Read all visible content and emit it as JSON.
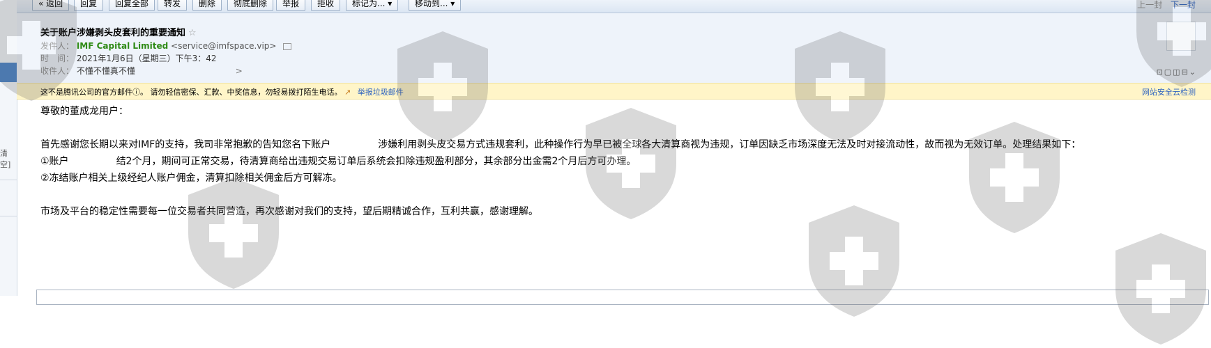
{
  "toolbar": {
    "back": "« 返回",
    "reply": "回复",
    "reply_all": "回复全部",
    "forward": "转发",
    "delete": "删除",
    "delete_permanently": "彻底删除",
    "report": "举报",
    "reject": "拒收",
    "mark_as": "标记为... ▾",
    "move_to": "移动到... ▾",
    "prev": "上一封",
    "next": "下一封"
  },
  "left": {
    "partial_label": "清空]"
  },
  "header": {
    "subject": "关于账户涉嫌剥头皮套利的重要通知",
    "star": "☆",
    "sender_label": "发件人：",
    "sender_name": "IMF Capital Limited",
    "sender_email": "<service@imfspace.vip>",
    "time_label": "时　间：",
    "time_value": "2021年1月6日（星期三）下午3：42",
    "recipient_label": "收件人：",
    "recipient_value": "不懂不懂真不懂",
    "recipient_more": ">",
    "tool_icons": "⊡▢◫⊟⌄"
  },
  "notice": {
    "text": "这不是腾讯公司的官方邮件ⓘ。  请勿轻信密保、汇款、中奖信息，勿轻易拨打陌生电话。",
    "report_icon": "↗",
    "report_label": "举报垃圾邮件",
    "security_check": "网站安全云检测"
  },
  "body": {
    "greeting": "尊敬的董成龙用户：",
    "para1_a": "首先感谢您长期以来对IMF的支持，我司非常抱歉的告知您名下账户",
    "para1_b": "涉嫌利用剥头皮交易方式违规套利，此种操作行为早已被全球各大清算商视为违规，订单因缺乏市场深度无法及时对接流动性，故而视为无效订单。处理结果如下：",
    "item1_a": "①账户",
    "item1_b": "结2个月，期间可正常交易，待清算商给出违规交易订单后系统会扣除违规盈利部分，其余部分出金需2个月后方可办理。",
    "item2": "②冻结账户相关上级经纪人账户佣金，清算扣除相关佣金后方可解冻。",
    "closing": "市场及平台的稳定性需要每一位交易者共同营造，再次感谢对我们的支持，望后期精诚合作，互利共赢，感谢理解。"
  },
  "colors": {
    "header_bg": "#eef3fa",
    "notice_bg": "#fff5c8",
    "sender_green": "#2e8a15",
    "link_blue": "#2b61c0"
  },
  "watermark_icon": "shield-cross-icon"
}
